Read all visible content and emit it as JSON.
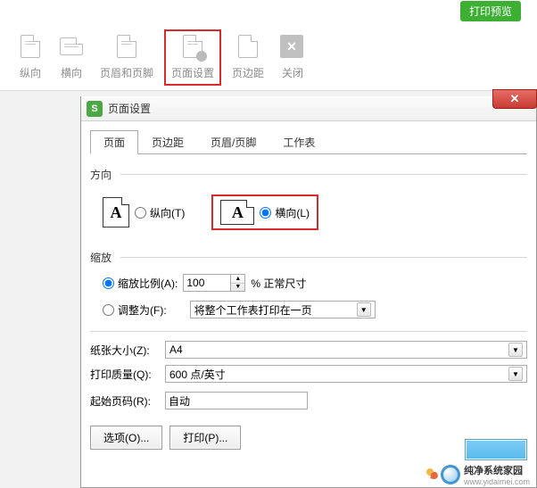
{
  "header": {
    "preview_btn": "打印预览"
  },
  "toolbar": {
    "portrait": "纵向",
    "landscape": "横向",
    "header_footer": "页眉和页脚",
    "page_setup": "页面设置",
    "margins": "页边距",
    "close": "关闭"
  },
  "dialog": {
    "title": "页面设置",
    "tabs": {
      "page": "页面",
      "margins": "页边距",
      "header_footer": "页眉/页脚",
      "sheet": "工作表"
    },
    "orientation": {
      "legend": "方向",
      "portrait": "纵向(T)",
      "landscape": "横向(L)",
      "icon_letter": "A"
    },
    "scaling": {
      "legend": "缩放",
      "adjust_to": "缩放比例(A):",
      "adjust_value": "100",
      "normal_size": "% 正常尺寸",
      "fit_to": "调整为(F):",
      "fit_value": "将整个工作表打印在一页"
    },
    "paper": {
      "size_label": "纸张大小(Z):",
      "size_value": "A4",
      "quality_label": "打印质量(Q):",
      "quality_value": "600 点/英寸",
      "first_page_label": "起始页码(R):",
      "first_page_value": "自动"
    },
    "buttons": {
      "options": "选项(O)...",
      "print": "打印(P)..."
    }
  },
  "watermark": {
    "title": "纯净系统家园",
    "url": "www.yidaimei.com"
  }
}
